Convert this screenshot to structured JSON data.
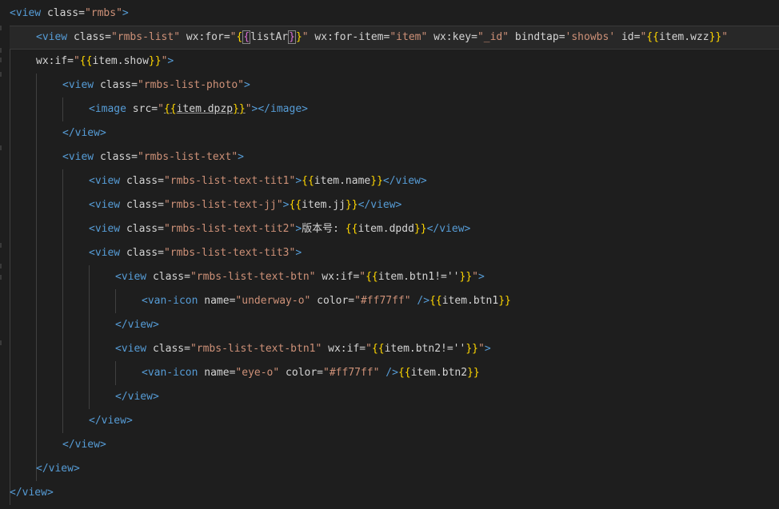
{
  "editor": {
    "language": "wxml",
    "colors": {
      "background": "#1e1e1e",
      "tag": "#569cd6",
      "string": "#ce9178",
      "brace_outer": "#ffd700",
      "brace_inner": "#da70d6",
      "text": "#d4d4d4"
    },
    "lines": [
      {
        "parts": [
          {
            "t": "<view",
            "c": "tag"
          },
          {
            "t": " class=",
            "c": "attr"
          },
          {
            "t": "\"rmbs\"",
            "c": "str"
          },
          {
            "t": ">",
            "c": "tag"
          }
        ]
      },
      {
        "current": true,
        "parts": [
          {
            "t": "<view",
            "c": "tag"
          },
          {
            "t": " class=",
            "c": "attr"
          },
          {
            "t": "\"rmbs-list\"",
            "c": "str"
          },
          {
            "t": " wx:for=",
            "c": "attr"
          },
          {
            "t": "\"",
            "c": "str"
          },
          {
            "t": "{",
            "c": "brace"
          },
          {
            "t": "{",
            "c": "brace2",
            "box": true
          },
          {
            "t": "listAr",
            "c": "text"
          },
          {
            "t": "}",
            "c": "brace2",
            "box": true
          },
          {
            "t": "}",
            "c": "brace"
          },
          {
            "t": "\"",
            "c": "str"
          },
          {
            "t": " wx:for-item=",
            "c": "attr"
          },
          {
            "t": "\"item\"",
            "c": "str"
          },
          {
            "t": " wx:key=",
            "c": "attr"
          },
          {
            "t": "\"_id\"",
            "c": "str"
          },
          {
            "t": " bindtap=",
            "c": "attr"
          },
          {
            "t": "'showbs'",
            "c": "str"
          },
          {
            "t": " id=",
            "c": "attr"
          },
          {
            "t": "\"",
            "c": "str"
          },
          {
            "t": "{{",
            "c": "brace"
          },
          {
            "t": "item.wzz",
            "c": "text"
          },
          {
            "t": "}}",
            "c": "brace"
          },
          {
            "t": "\"",
            "c": "str"
          }
        ]
      },
      {
        "parts": [
          {
            "t": "wx:if=",
            "c": "attr"
          },
          {
            "t": "\"",
            "c": "str"
          },
          {
            "t": "{{",
            "c": "brace"
          },
          {
            "t": "item.show",
            "c": "text"
          },
          {
            "t": "}}",
            "c": "brace"
          },
          {
            "t": "\"",
            "c": "str"
          },
          {
            "t": ">",
            "c": "tag"
          }
        ]
      },
      {
        "parts": [
          {
            "t": "<view",
            "c": "tag"
          },
          {
            "t": " class=",
            "c": "attr"
          },
          {
            "t": "\"rmbs-list-photo\"",
            "c": "str"
          },
          {
            "t": ">",
            "c": "tag"
          }
        ]
      },
      {
        "parts": [
          {
            "t": "<image",
            "c": "tag"
          },
          {
            "t": " src=",
            "c": "attr"
          },
          {
            "t": "\"",
            "c": "str"
          },
          {
            "t": "{{",
            "c": "brace",
            "u": true
          },
          {
            "t": "item.dpzp",
            "c": "text",
            "u": true
          },
          {
            "t": "}}",
            "c": "brace",
            "u": true
          },
          {
            "t": "\"",
            "c": "str"
          },
          {
            "t": "></image>",
            "c": "tag"
          }
        ]
      },
      {
        "parts": [
          {
            "t": "</view>",
            "c": "tag"
          }
        ]
      },
      {
        "parts": [
          {
            "t": "<view",
            "c": "tag"
          },
          {
            "t": " class=",
            "c": "attr"
          },
          {
            "t": "\"rmbs-list-text\"",
            "c": "str"
          },
          {
            "t": ">",
            "c": "tag"
          }
        ]
      },
      {
        "parts": [
          {
            "t": "<view",
            "c": "tag"
          },
          {
            "t": " class=",
            "c": "attr"
          },
          {
            "t": "\"rmbs-list-text-tit1\"",
            "c": "str"
          },
          {
            "t": ">",
            "c": "tag"
          },
          {
            "t": "{{",
            "c": "brace"
          },
          {
            "t": "item.name",
            "c": "text"
          },
          {
            "t": "}}",
            "c": "brace"
          },
          {
            "t": "</view>",
            "c": "tag"
          }
        ]
      },
      {
        "parts": [
          {
            "t": "<view",
            "c": "tag"
          },
          {
            "t": " class=",
            "c": "attr"
          },
          {
            "t": "\"rmbs-list-text-jj\"",
            "c": "str"
          },
          {
            "t": ">",
            "c": "tag"
          },
          {
            "t": "{{",
            "c": "brace"
          },
          {
            "t": "item.jj",
            "c": "text"
          },
          {
            "t": "}}",
            "c": "brace"
          },
          {
            "t": "</view>",
            "c": "tag"
          }
        ]
      },
      {
        "parts": [
          {
            "t": "<view",
            "c": "tag"
          },
          {
            "t": " class=",
            "c": "attr"
          },
          {
            "t": "\"rmbs-list-text-tit2\"",
            "c": "str"
          },
          {
            "t": ">",
            "c": "tag"
          },
          {
            "t": "版本号: ",
            "c": "text"
          },
          {
            "t": "{{",
            "c": "brace"
          },
          {
            "t": "item.dpdd",
            "c": "text"
          },
          {
            "t": "}}",
            "c": "brace"
          },
          {
            "t": "</view>",
            "c": "tag"
          }
        ]
      },
      {
        "parts": [
          {
            "t": "<view",
            "c": "tag"
          },
          {
            "t": " class=",
            "c": "attr"
          },
          {
            "t": "\"rmbs-list-text-tit3\"",
            "c": "str"
          },
          {
            "t": ">",
            "c": "tag"
          }
        ]
      },
      {
        "parts": [
          {
            "t": "<view",
            "c": "tag"
          },
          {
            "t": " class=",
            "c": "attr"
          },
          {
            "t": "\"rmbs-list-text-btn\"",
            "c": "str"
          },
          {
            "t": " wx:if=",
            "c": "attr"
          },
          {
            "t": "\"",
            "c": "str"
          },
          {
            "t": "{{",
            "c": "brace"
          },
          {
            "t": "item.btn1!=''",
            "c": "text"
          },
          {
            "t": "}}",
            "c": "brace"
          },
          {
            "t": "\"",
            "c": "str"
          },
          {
            "t": ">",
            "c": "tag"
          }
        ]
      },
      {
        "parts": [
          {
            "t": "<van-icon",
            "c": "tag"
          },
          {
            "t": " name=",
            "c": "attr"
          },
          {
            "t": "\"underway-o\"",
            "c": "str"
          },
          {
            "t": " color=",
            "c": "attr"
          },
          {
            "t": "\"#ff77ff\"",
            "c": "str"
          },
          {
            "t": " />",
            "c": "tag"
          },
          {
            "t": "{{",
            "c": "brace"
          },
          {
            "t": "item.btn1",
            "c": "text"
          },
          {
            "t": "}}",
            "c": "brace"
          }
        ]
      },
      {
        "parts": [
          {
            "t": "</view>",
            "c": "tag"
          }
        ]
      },
      {
        "parts": [
          {
            "t": "<view",
            "c": "tag"
          },
          {
            "t": " class=",
            "c": "attr"
          },
          {
            "t": "\"rmbs-list-text-btn1\"",
            "c": "str"
          },
          {
            "t": " wx:if=",
            "c": "attr"
          },
          {
            "t": "\"",
            "c": "str"
          },
          {
            "t": "{{",
            "c": "brace"
          },
          {
            "t": "item.btn2!=''",
            "c": "text"
          },
          {
            "t": "}}",
            "c": "brace"
          },
          {
            "t": "\"",
            "c": "str"
          },
          {
            "t": ">",
            "c": "tag"
          }
        ]
      },
      {
        "parts": [
          {
            "t": "<van-icon",
            "c": "tag"
          },
          {
            "t": " name=",
            "c": "attr"
          },
          {
            "t": "\"eye-o\"",
            "c": "str"
          },
          {
            "t": " color=",
            "c": "attr"
          },
          {
            "t": "\"#ff77ff\"",
            "c": "str"
          },
          {
            "t": " />",
            "c": "tag"
          },
          {
            "t": "{{",
            "c": "brace"
          },
          {
            "t": "item.btn2",
            "c": "text"
          },
          {
            "t": "}}",
            "c": "brace"
          }
        ]
      },
      {
        "parts": [
          {
            "t": "</view>",
            "c": "tag"
          }
        ]
      },
      {
        "parts": [
          {
            "t": "</view>",
            "c": "tag"
          }
        ]
      },
      {
        "parts": [
          {
            "t": "</view>",
            "c": "tag"
          }
        ]
      },
      {
        "parts": [
          {
            "t": "</view>",
            "c": "tag"
          }
        ]
      },
      {
        "parts": [
          {
            "t": "</view>",
            "c": "tag"
          }
        ]
      }
    ]
  }
}
